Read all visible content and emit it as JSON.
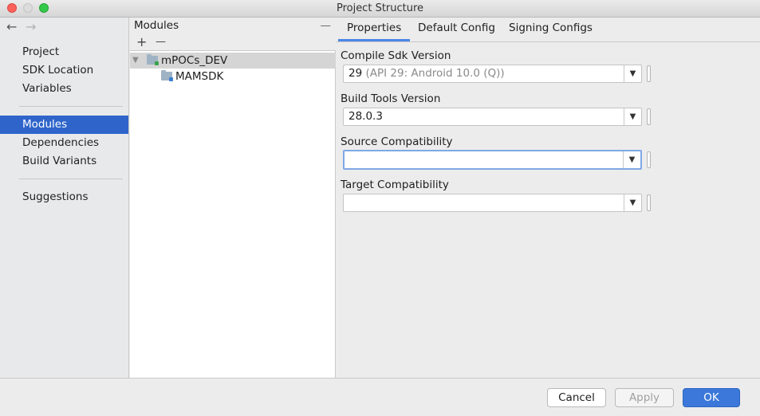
{
  "window": {
    "title": "Project Structure"
  },
  "nav": {
    "back_icon": "arrow-left-icon",
    "forward_icon": "arrow-right-icon",
    "items": [
      {
        "label": "Project"
      },
      {
        "label": "SDK Location"
      },
      {
        "label": "Variables"
      },
      {
        "label": "Modules",
        "selected": true
      },
      {
        "label": "Dependencies"
      },
      {
        "label": "Build Variants"
      },
      {
        "label": "Suggestions"
      }
    ]
  },
  "modules": {
    "header": "Modules",
    "collapse_symbol": "—",
    "add_symbol": "+",
    "remove_symbol": "—",
    "tree": [
      {
        "label": "mPOCs_DEV",
        "expanded": true,
        "selected": true
      },
      {
        "label": "MAMSDK"
      }
    ]
  },
  "tabs": [
    {
      "label": "Properties",
      "active": true
    },
    {
      "label": "Default Config"
    },
    {
      "label": "Signing Configs"
    }
  ],
  "properties": {
    "compile_sdk": {
      "label": "Compile Sdk Version",
      "value": "29",
      "hint": "(API 29: Android 10.0 (Q))"
    },
    "build_tools": {
      "label": "Build Tools Version",
      "value": "28.0.3"
    },
    "source_compat": {
      "label": "Source Compatibility",
      "value": ""
    },
    "target_compat": {
      "label": "Target Compatibility",
      "value": ""
    }
  },
  "footer": {
    "cancel": "Cancel",
    "apply": "Apply",
    "ok": "OK"
  },
  "colors": {
    "accent": "#2f65ca",
    "ok_button": "#3b78d9",
    "tab_underline": "#4a86e8"
  }
}
